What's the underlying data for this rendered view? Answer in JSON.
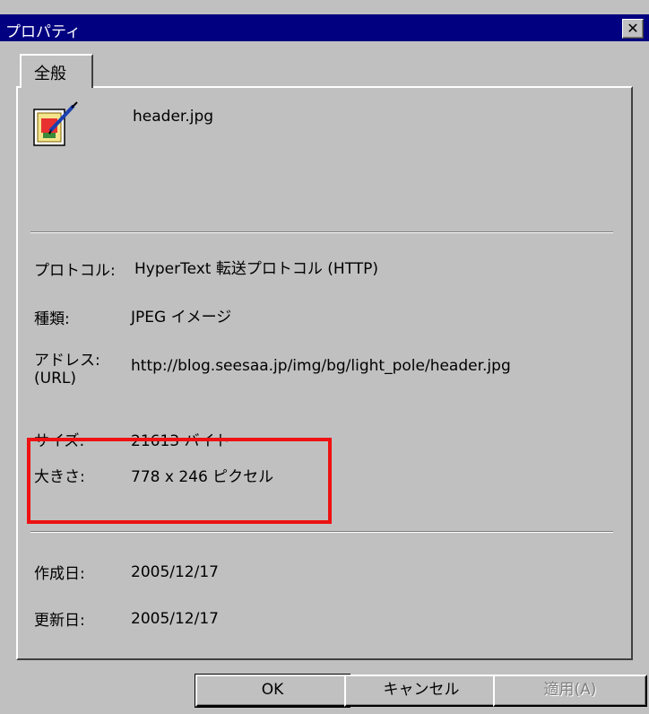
{
  "window": {
    "title": "プロパティ",
    "close_glyph": "✕"
  },
  "tabs": [
    {
      "label": "全般"
    }
  ],
  "file": {
    "name": "header.jpg",
    "icon": "image-file-icon"
  },
  "properties": {
    "protocol": {
      "label": "プロトコル:",
      "value": "HyperText 転送プロトコル (HTTP)"
    },
    "type": {
      "label": "種類:",
      "value": "JPEG イメージ"
    },
    "address": {
      "label_line1": "アドレス:",
      "label_line2": "(URL)",
      "value": "http://blog.seesaa.jp/img/bg/light_pole/header.jpg"
    },
    "size": {
      "label": "サイズ:",
      "value": "21613 バイト"
    },
    "dimensions": {
      "label": "大きさ:",
      "value": "778  x  246  ピクセル"
    },
    "created": {
      "label": "作成日:",
      "value": "2005/12/17"
    },
    "modified": {
      "label": "更新日:",
      "value": "2005/12/17"
    }
  },
  "buttons": {
    "ok": "OK",
    "cancel": "キャンセル",
    "apply": "適用(A)"
  },
  "colors": {
    "titlebar": "#000080",
    "highlight": "#ee1111",
    "face": "#c0c0c0"
  }
}
